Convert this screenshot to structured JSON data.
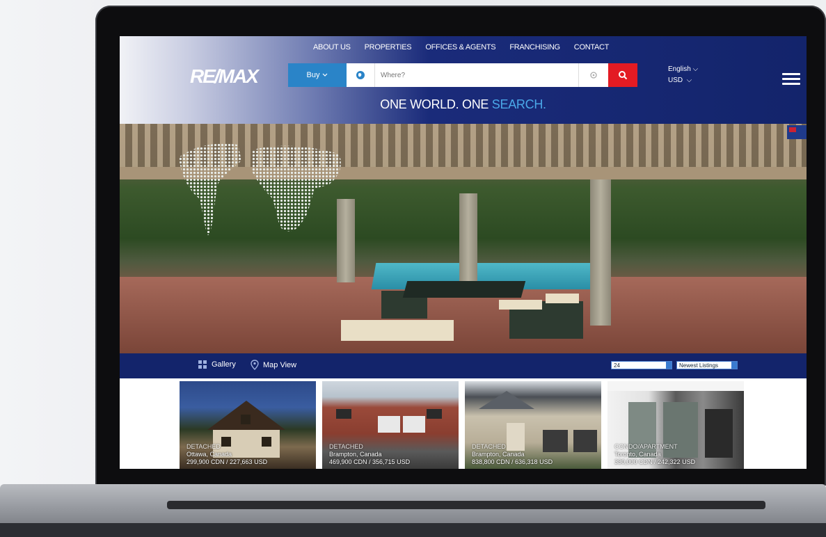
{
  "topnav": {
    "items": [
      "ABOUT US",
      "PROPERTIES",
      "OFFICES & AGENTS",
      "FRANCHISING",
      "CONTACT"
    ]
  },
  "brand": {
    "logo": "RE/MAX"
  },
  "search": {
    "type_label": "Buy",
    "placeholder": "Where?"
  },
  "locale": {
    "language": "English",
    "currency": "USD"
  },
  "tagline": {
    "part1": "ONE WORLD. ONE ",
    "part2": "SEARCH."
  },
  "viewbar": {
    "gallery_label": "Gallery",
    "map_label": "Map View",
    "per_page": "24",
    "sort": "Newest Listings"
  },
  "listings": [
    {
      "type": "DETACHED",
      "location": "Ottawa, Canada",
      "price": "299,900 CDN / 227,663 USD"
    },
    {
      "type": "DETACHED",
      "location": "Brampton, Canada",
      "price": "469,900 CDN / 356,715 USD"
    },
    {
      "type": "DETACHED",
      "location": "Brampton, Canada",
      "price": "838,800 CDN / 636,318 USD"
    },
    {
      "type": "CONDO/APARTMENT",
      "location": "Toronto, Canada",
      "price": "330,000 CDN / 242,322 USD"
    }
  ],
  "colors": {
    "navy": "#13246b",
    "buy_blue": "#2a84c8",
    "search_red": "#e31b23",
    "accent_blue": "#4aa8e8"
  }
}
